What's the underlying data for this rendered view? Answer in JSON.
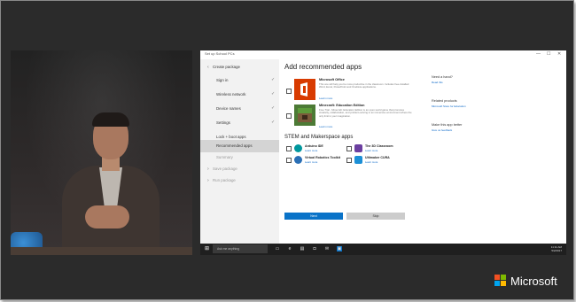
{
  "window": {
    "title": "Set up School PCs",
    "minimize": "—",
    "maximize": "☐",
    "close": "✕"
  },
  "sidebar": {
    "items": [
      {
        "label": "Create package",
        "check": ""
      },
      {
        "label": "Sign in",
        "check": "✓"
      },
      {
        "label": "Wireless network",
        "check": "✓"
      },
      {
        "label": "Device names",
        "check": "✓"
      },
      {
        "label": "Settings",
        "check": "✓"
      },
      {
        "label": "Lock + boot apps",
        "check": ""
      },
      {
        "label": "Recommended apps",
        "check": ""
      },
      {
        "label": "Summary",
        "check": ""
      },
      {
        "label": "Save package",
        "check": ""
      },
      {
        "label": "Run package",
        "check": ""
      }
    ]
  },
  "main": {
    "heading": "Add recommended apps",
    "apps": [
      {
        "name": "Microsoft Office",
        "desc": "This one will help you be more productive in the classroom. Includes free-installed Word, Excel, PowerPoint and OneNote applications.",
        "link": "Learn more"
      },
      {
        "name": "Minecraft: Education Edition",
        "desc": "Free Trial - Minecraft: Education Edition is an open-world game that promotes creativity, collaboration, and problem-solving in an immersive environment where the only limit is your imagination.",
        "link": "Learn more"
      }
    ],
    "stem_heading": "STEM and Makerspace apps",
    "stem_apps": [
      {
        "name": "Arduino IDE",
        "link": "Learn more"
      },
      {
        "name": "The 3D Classroom",
        "link": "Learn more"
      },
      {
        "name": "Virtual Robotics Toolkit",
        "link": "Learn more"
      },
      {
        "name": "Ultimaker CURA",
        "link": "Learn more"
      }
    ],
    "right": {
      "help_heading": "Need a hand?",
      "help_link": "Read this",
      "related_heading": "Related products",
      "related_link": "Microsoft Store for Education",
      "better_heading": "Make this app better",
      "better_link": "Give us feedback"
    },
    "next_label": "Next",
    "skip_label": "Skip"
  },
  "taskbar": {
    "search_placeholder": "Ask me anything",
    "time": "11:11 AM",
    "date": "5/2/2017"
  },
  "brand": {
    "name": "Microsoft",
    "colors": [
      "#f25022",
      "#7fba00",
      "#00a4ef",
      "#ffb900"
    ]
  },
  "colors": {
    "accent": "#0a73c8",
    "office_red": "#d83b01",
    "minecraft_green": "#4c7a35"
  }
}
